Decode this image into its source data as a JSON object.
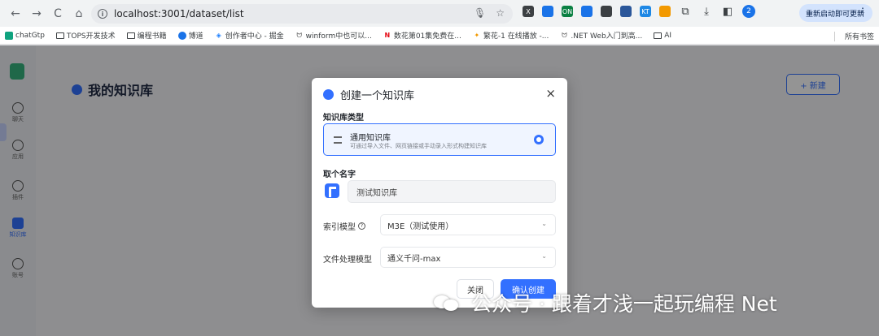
{
  "browser": {
    "back": "←",
    "forward": "→",
    "reload": "C",
    "home": "⌂",
    "url": "localhost:3001/dataset/list",
    "update_label": "重新启动即可更新",
    "profile_initial": "2",
    "menu": "⋮",
    "extensions": [
      {
        "name": "X",
        "color": "#3c4043"
      },
      {
        "name": "",
        "color": "#1a73e8"
      },
      {
        "name": "ON",
        "color": "#0b8043"
      },
      {
        "name": "",
        "color": "#1a73e8"
      },
      {
        "name": "",
        "color": "#3c4043"
      },
      {
        "name": "",
        "color": "#2b579a"
      },
      {
        "name": "KT",
        "color": "#1e88e5"
      },
      {
        "name": "",
        "color": "#f29900"
      }
    ]
  },
  "bookmarks": {
    "items": [
      {
        "label": "chatGtp"
      },
      {
        "label": "TOPS开发技术"
      },
      {
        "label": "编程书籍"
      },
      {
        "label": "博道"
      },
      {
        "label": "创作者中心 - 掘金"
      },
      {
        "label": "winform中也可以..."
      },
      {
        "label": "数花第01集免费在..."
      },
      {
        "label": "繁花-1 在线播放 -..."
      },
      {
        "label": ".NET Web入门到高..."
      },
      {
        "label": "AI"
      }
    ],
    "all_bookmarks": "所有书签"
  },
  "sidebar": {
    "items": [
      {
        "label": "聊天"
      },
      {
        "label": "应用"
      },
      {
        "label": "插件"
      },
      {
        "label": "知识库"
      },
      {
        "label": "账号"
      }
    ]
  },
  "page": {
    "title": "我的知识库",
    "new_button": "+ 新建"
  },
  "modal": {
    "title": "创建一个知识库",
    "close": "×",
    "type_section": "知识库类型",
    "type_name": "通用知识库",
    "type_desc": "可通过导入文件、网页链接或手动录入形式构建知识库",
    "name_section": "取个名字",
    "name_value": "测试知识库",
    "index_label": "索引模型",
    "index_help": "?",
    "index_value": "M3E（测试使用）",
    "file_label": "文件处理模型",
    "file_value": "通义千问-max",
    "chevron": "⌄",
    "cancel_button": "关闭",
    "confirm_button": "确认创建"
  },
  "watermark": {
    "text": "公众号 · 跟着才浅一起玩编程 Net"
  }
}
